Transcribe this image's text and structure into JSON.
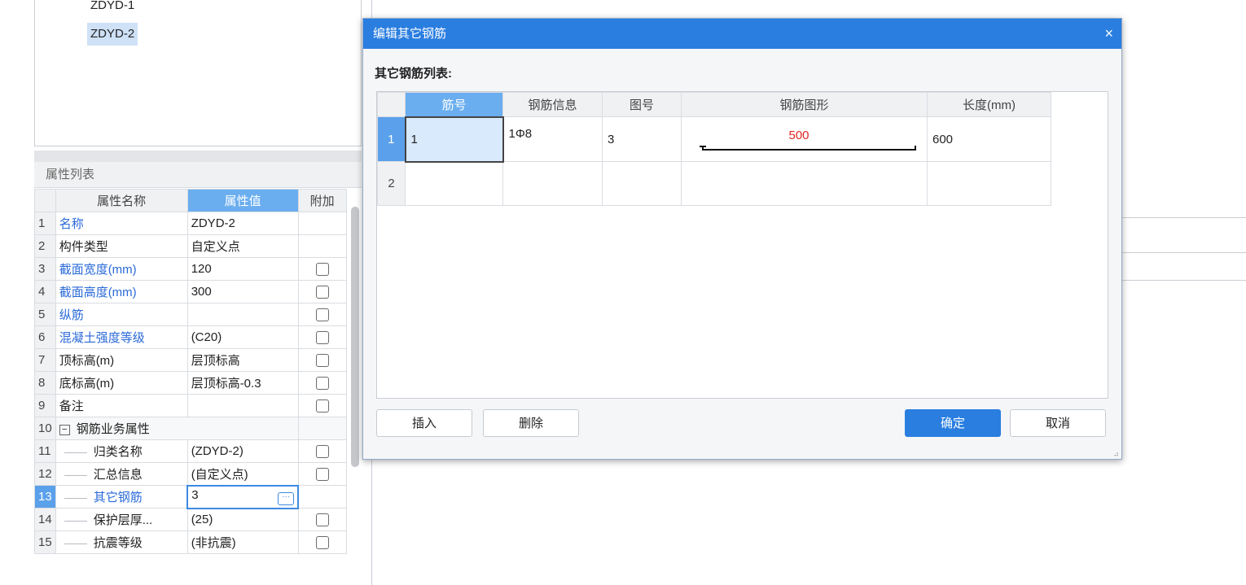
{
  "tree": {
    "items": [
      {
        "label": "ZDYD-1",
        "selected": false
      },
      {
        "label": "ZDYD-2",
        "selected": true
      }
    ]
  },
  "properties": {
    "panel_title": "属性列表",
    "headers": {
      "name": "属性名称",
      "value": "属性值",
      "extra": "附加"
    },
    "rows": [
      {
        "num": "1",
        "name": "名称",
        "value": "ZDYD-2",
        "blue": true,
        "checkbox": false
      },
      {
        "num": "2",
        "name": "构件类型",
        "value": "自定义点",
        "blue": false,
        "checkbox": false
      },
      {
        "num": "3",
        "name": "截面宽度(mm)",
        "value": "120",
        "blue": true,
        "checkbox": true
      },
      {
        "num": "4",
        "name": "截面高度(mm)",
        "value": "300",
        "blue": true,
        "checkbox": true
      },
      {
        "num": "5",
        "name": "纵筋",
        "value": "",
        "blue": true,
        "checkbox": true
      },
      {
        "num": "6",
        "name": "混凝土强度等级",
        "value": "(C20)",
        "blue": true,
        "checkbox": true
      },
      {
        "num": "7",
        "name": "顶标高(m)",
        "value": "层顶标高",
        "blue": false,
        "checkbox": true
      },
      {
        "num": "8",
        "name": "底标高(m)",
        "value": "层顶标高-0.3",
        "blue": false,
        "checkbox": true
      },
      {
        "num": "9",
        "name": "备注",
        "value": "",
        "blue": false,
        "checkbox": true
      },
      {
        "num": "10",
        "name": "钢筋业务属性",
        "value": "",
        "group": true
      },
      {
        "num": "11",
        "name": "归类名称",
        "value": "(ZDYD-2)",
        "child": true,
        "checkbox": true
      },
      {
        "num": "12",
        "name": "汇总信息",
        "value": "(自定义点)",
        "child": true,
        "checkbox": true
      },
      {
        "num": "13",
        "name": "其它钢筋",
        "value": "3",
        "child": true,
        "blue": true,
        "selected": true,
        "editing": true
      },
      {
        "num": "14",
        "name": "保护层厚...",
        "value": "(25)",
        "child": true,
        "checkbox": true
      },
      {
        "num": "15",
        "name": "抗震等级",
        "value": "(非抗震)",
        "child": true,
        "checkbox": true
      }
    ]
  },
  "dialog": {
    "title": "编辑其它钢筋",
    "close_glyph": "×",
    "list_label": "其它钢筋列表:",
    "columns": [
      "筋号",
      "钢筋信息",
      "图号",
      "钢筋图形",
      "长度(mm)"
    ],
    "rows": [
      {
        "num": "1",
        "bar_no": "1",
        "info": "1Φ8",
        "fig_no": "3",
        "shape_value": "500",
        "length": "600"
      },
      {
        "num": "2",
        "bar_no": "",
        "info": "",
        "fig_no": "",
        "shape_value": "",
        "length": ""
      }
    ],
    "buttons": {
      "insert": "插入",
      "delete": "删除",
      "ok": "确定",
      "cancel": "取消"
    },
    "accent_color": "#2a7ee0",
    "shape_text_color": "#e0261e"
  }
}
